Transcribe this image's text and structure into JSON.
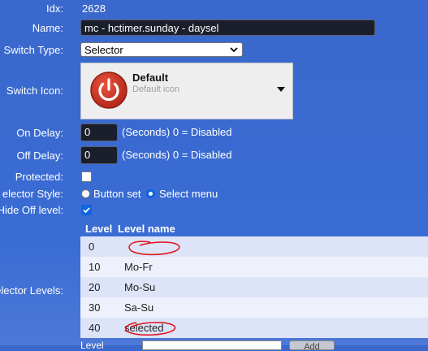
{
  "idx": {
    "label": "Idx:",
    "value": "2628"
  },
  "name": {
    "label": "Name:",
    "value": "mc - hctimer.sunday - daysel"
  },
  "switch_type": {
    "label": "Switch Type:",
    "value": "Selector"
  },
  "switch_icon": {
    "label": "Switch Icon:",
    "title": "Default",
    "subtitle": "Default icon",
    "icon": "power-icon",
    "icon_color": "#c0392b"
  },
  "on_delay": {
    "label": "On Delay:",
    "value": "0",
    "suffix": "(Seconds) 0 = Disabled"
  },
  "off_delay": {
    "label": "Off Delay:",
    "value": "0",
    "suffix": "(Seconds) 0 = Disabled"
  },
  "protected": {
    "label": "Protected:",
    "checked": false
  },
  "selector_style": {
    "label": "elector Style:",
    "option_button_set": "Button set",
    "option_select_menu": "Select menu",
    "selected": "Select menu"
  },
  "hide_off_level": {
    "label": "Hide Off level:",
    "checked": true
  },
  "selector_levels": {
    "label": "elector Levels:",
    "header_level": "Level",
    "header_name": "Level name",
    "rows": [
      {
        "level": "0",
        "name": ""
      },
      {
        "level": "10",
        "name": "Mo-Fr"
      },
      {
        "level": "20",
        "name": "Mo-Su"
      },
      {
        "level": "30",
        "name": "Sa-Su"
      },
      {
        "level": "40",
        "name": "selected"
      }
    ]
  },
  "bottom": {
    "level_label": "Level",
    "add_button": "Add"
  },
  "colors": {
    "background": "#3a68cc",
    "accent": "#0b66e0",
    "annotation": "#e0101a"
  }
}
